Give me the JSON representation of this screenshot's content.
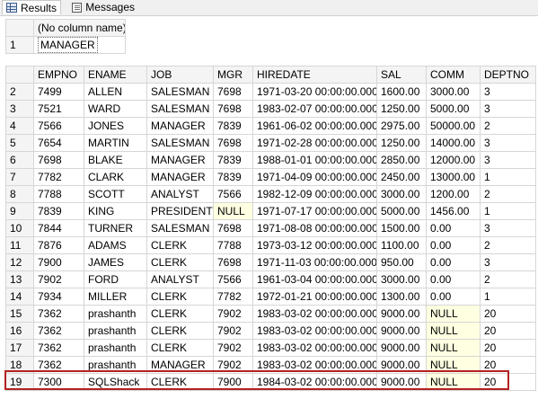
{
  "tabs": [
    {
      "label": "Results",
      "icon": "results-grid-icon",
      "active": true
    },
    {
      "label": "Messages",
      "icon": "messages-icon",
      "active": false
    }
  ],
  "result1": {
    "columns": [
      "(No column name)"
    ],
    "rows": [
      {
        "rownum": "1",
        "cells": [
          "MANAGER"
        ]
      }
    ]
  },
  "result2": {
    "columns": [
      "EMPNO",
      "ENAME",
      "JOB",
      "MGR",
      "HIREDATE",
      "SAL",
      "COMM",
      "DEPTNO"
    ],
    "rows": [
      {
        "rownum": "2",
        "cells": [
          "7499",
          "ALLEN",
          "SALESMAN",
          "7698",
          "1971-03-20 00:00:00.000",
          "1600.00",
          "3000.00",
          "3"
        ]
      },
      {
        "rownum": "3",
        "cells": [
          "7521",
          "WARD",
          "SALESMAN",
          "7698",
          "1983-02-07 00:00:00.000",
          "1250.00",
          "5000.00",
          "3"
        ]
      },
      {
        "rownum": "4",
        "cells": [
          "7566",
          "JONES",
          "MANAGER",
          "7839",
          "1961-06-02 00:00:00.000",
          "2975.00",
          "50000.00",
          "2"
        ]
      },
      {
        "rownum": "5",
        "cells": [
          "7654",
          "MARTIN",
          "SALESMAN",
          "7698",
          "1971-02-28 00:00:00.000",
          "1250.00",
          "14000.00",
          "3"
        ]
      },
      {
        "rownum": "6",
        "cells": [
          "7698",
          "BLAKE",
          "MANAGER",
          "7839",
          "1988-01-01 00:00:00.000",
          "2850.00",
          "12000.00",
          "3"
        ]
      },
      {
        "rownum": "7",
        "cells": [
          "7782",
          "CLARK",
          "MANAGER",
          "7839",
          "1971-04-09 00:00:00.000",
          "2450.00",
          "13000.00",
          "1"
        ]
      },
      {
        "rownum": "8",
        "cells": [
          "7788",
          "SCOTT",
          "ANALYST",
          "7566",
          "1982-12-09 00:00:00.000",
          "3000.00",
          "1200.00",
          "2"
        ]
      },
      {
        "rownum": "9",
        "cells": [
          "7839",
          "KING",
          "PRESIDENT",
          "NULL",
          "1971-07-17 00:00:00.000",
          "5000.00",
          "1456.00",
          "1"
        ]
      },
      {
        "rownum": "10",
        "cells": [
          "7844",
          "TURNER",
          "SALESMAN",
          "7698",
          "1971-08-08 00:00:00.000",
          "1500.00",
          "0.00",
          "3"
        ]
      },
      {
        "rownum": "11",
        "cells": [
          "7876",
          "ADAMS",
          "CLERK",
          "7788",
          "1973-03-12 00:00:00.000",
          "1100.00",
          "0.00",
          "2"
        ]
      },
      {
        "rownum": "12",
        "cells": [
          "7900",
          "JAMES",
          "CLERK",
          "7698",
          "1971-11-03 00:00:00.000",
          "950.00",
          "0.00",
          "3"
        ]
      },
      {
        "rownum": "13",
        "cells": [
          "7902",
          "FORD",
          "ANALYST",
          "7566",
          "1961-03-04 00:00:00.000",
          "3000.00",
          "0.00",
          "2"
        ]
      },
      {
        "rownum": "14",
        "cells": [
          "7934",
          "MILLER",
          "CLERK",
          "7782",
          "1972-01-21 00:00:00.000",
          "1300.00",
          "0.00",
          "1"
        ]
      },
      {
        "rownum": "15",
        "cells": [
          "7362",
          "prashanth",
          "CLERK",
          "7902",
          "1983-03-02 00:00:00.000",
          "9000.00",
          "NULL",
          "20"
        ]
      },
      {
        "rownum": "16",
        "cells": [
          "7362",
          "prashanth",
          "CLERK",
          "7902",
          "1983-03-02 00:00:00.000",
          "9000.00",
          "NULL",
          "20"
        ]
      },
      {
        "rownum": "17",
        "cells": [
          "7362",
          "prashanth",
          "CLERK",
          "7902",
          "1983-03-02 00:00:00.000",
          "9000.00",
          "NULL",
          "20"
        ]
      },
      {
        "rownum": "18",
        "cells": [
          "7362",
          "prashanth",
          "MANAGER",
          "7902",
          "1983-03-02 00:00:00.000",
          "9000.00",
          "NULL",
          "20"
        ]
      },
      {
        "rownum": "19",
        "cells": [
          "7300",
          "SQLShack",
          "CLERK",
          "7900",
          "1984-03-02 00:00:00.000",
          "9000.00",
          "NULL",
          "20"
        ],
        "highlighted": true
      }
    ]
  },
  "colors": {
    "null_cell": "#ffffe1",
    "highlight_border": "#b22222",
    "header_bg": "#f4f4f4"
  }
}
